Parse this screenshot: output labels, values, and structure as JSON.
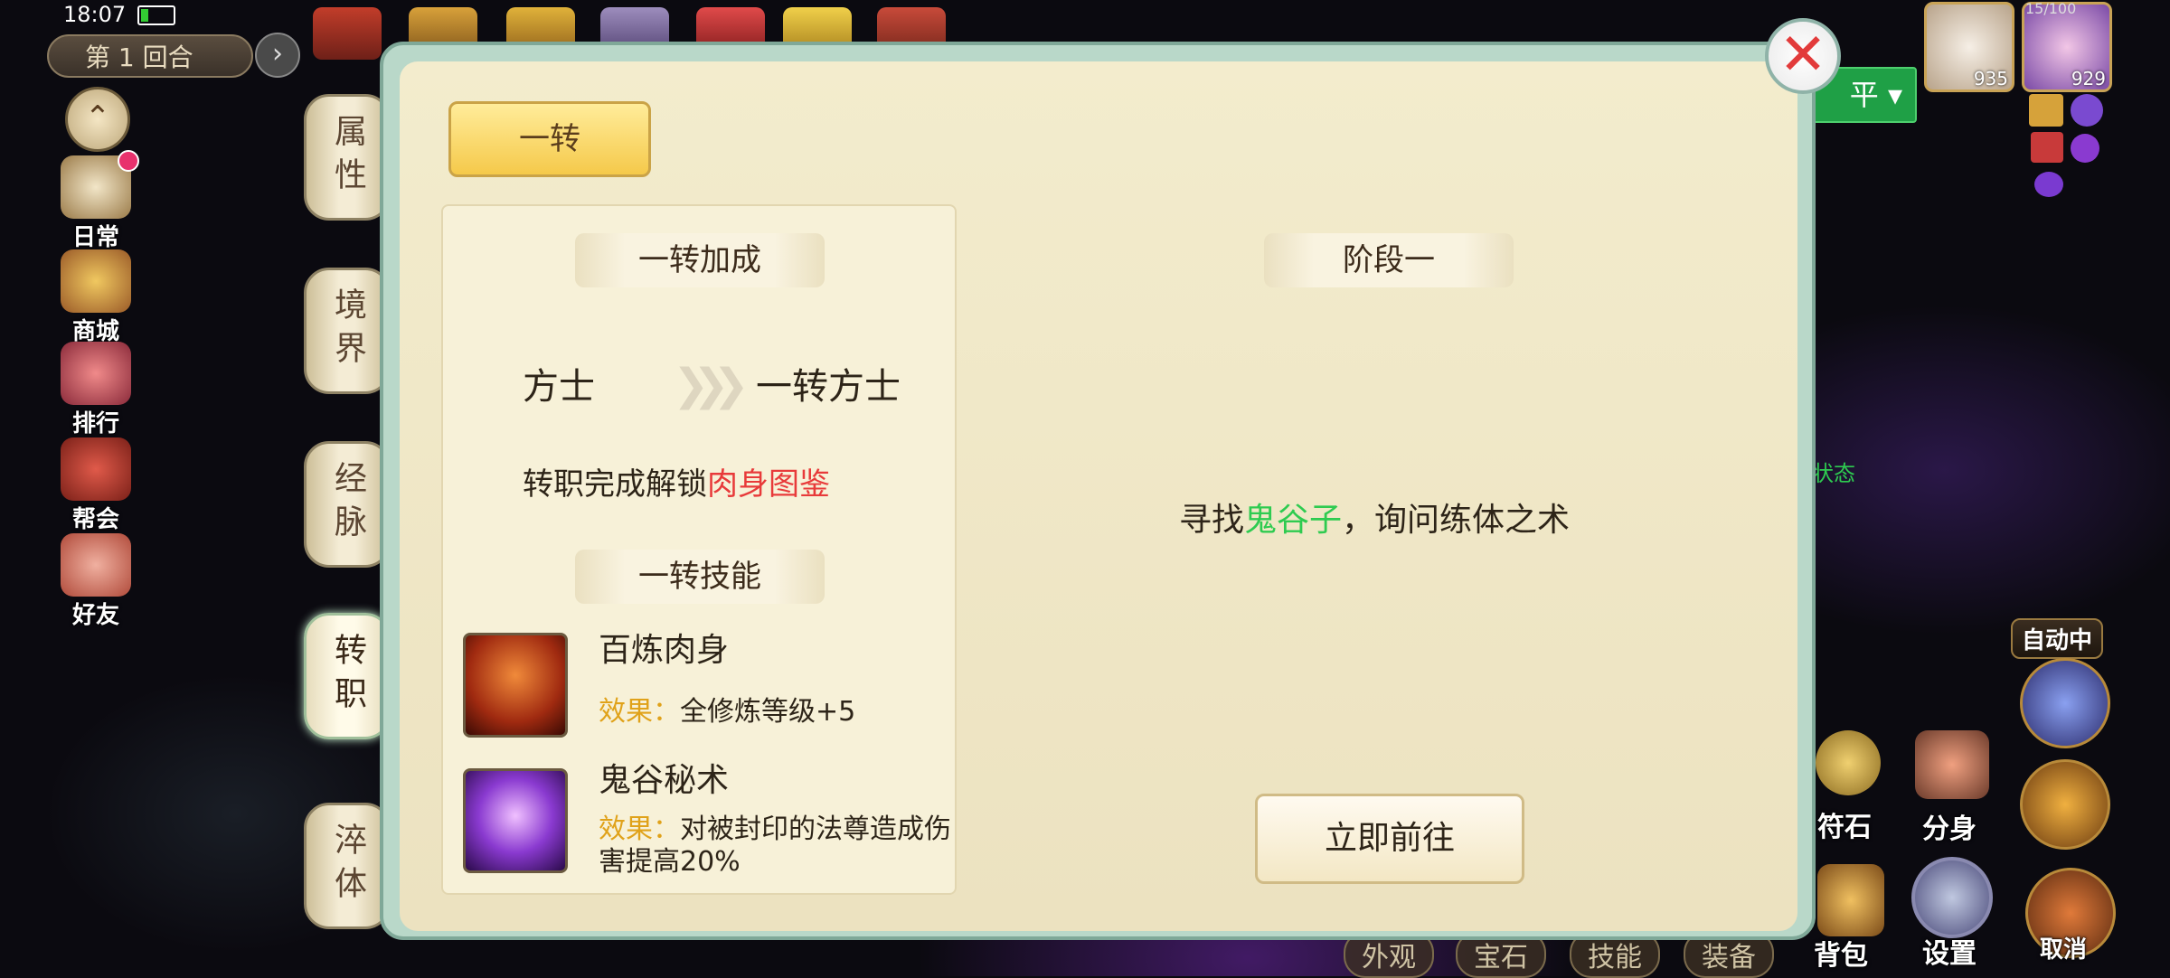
{
  "status_bar": {
    "time": "18:07"
  },
  "hud": {
    "round_label": "第 1 回合",
    "side_menu": [
      {
        "label": "日常"
      },
      {
        "label": "商城"
      },
      {
        "label": "排行"
      },
      {
        "label": "帮会"
      },
      {
        "label": "好友"
      }
    ],
    "avatar_levels": [
      "935",
      "929"
    ],
    "hp_text": "15/100",
    "right_tag": "平",
    "state_text": "状态",
    "auto_label": "自动中",
    "right_buttons": [
      "符石",
      "分身",
      "设置",
      "取消"
    ],
    "bottom_tabs": [
      "外观",
      "宝石",
      "技能",
      "装备",
      "背包"
    ]
  },
  "tabs": [
    {
      "label": "属性"
    },
    {
      "label": "境界"
    },
    {
      "label": "经脉"
    },
    {
      "label": "转职"
    },
    {
      "label": "淬体"
    }
  ],
  "panel": {
    "rank_button": "一转",
    "bonus_title": "一转加成",
    "from_class": "方士",
    "to_class": "一转方士",
    "unlock_prefix": "转职完成解锁",
    "unlock_highlight": "肉身图鉴",
    "skills_title": "一转技能",
    "skills": [
      {
        "name": "百炼肉身",
        "effect_label": "效果：",
        "effect": "全修炼等级+5"
      },
      {
        "name": "鬼谷秘术",
        "effect_label": "效果：",
        "effect": "对被封印的法尊造成伤害提高20%"
      }
    ],
    "stage_title": "阶段一",
    "task_prefix": "寻找",
    "task_npc": "鬼谷子",
    "task_suffix": "，询问练体之术",
    "go_button": "立即前往"
  },
  "colors": {
    "highlight_red": "#e83a3a",
    "npc_green": "#2ecb50",
    "effect_gold": "#e0a21a"
  }
}
